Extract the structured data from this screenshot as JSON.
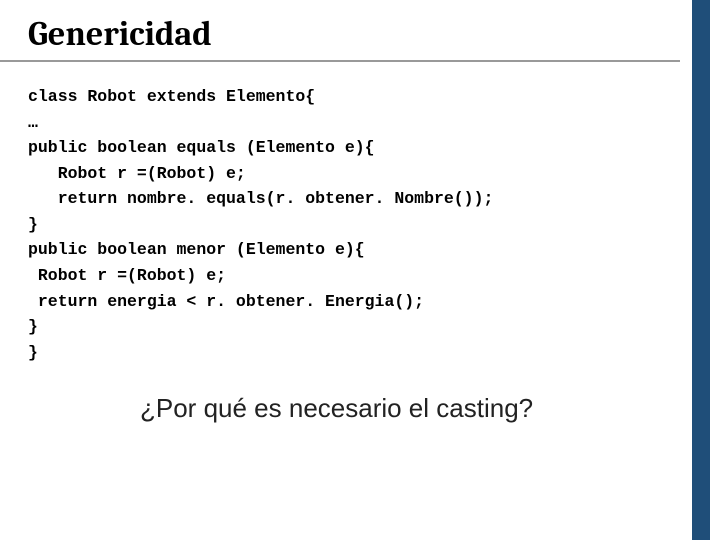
{
  "title": "Genericidad",
  "code": {
    "l1": "class Robot extends Elemento{",
    "l2": "…",
    "l3": "public boolean equals (Elemento e){",
    "l4": "   Robot r =(Robot) e;",
    "l5": "   return nombre. equals(r. obtener. Nombre());",
    "l6": "}",
    "l7": "public boolean menor (Elemento e){",
    "l8": " Robot r =(Robot) e;",
    "l9": " return energia < r. obtener. Energia();",
    "l10": "}",
    "l11": "}"
  },
  "question": "¿Por qué es necesario el casting?"
}
